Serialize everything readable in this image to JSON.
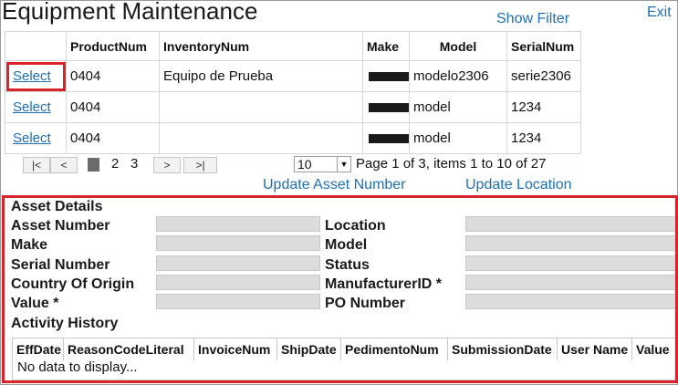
{
  "header": {
    "title": "Equipment Maintenance",
    "show_filter": "Show Filter",
    "exit": "Exit"
  },
  "grid": {
    "columns": [
      "",
      "ProductNum",
      "InventoryNum",
      "Make",
      "Model",
      "SerialNum"
    ],
    "rows": [
      {
        "select": "Select",
        "product": "0404",
        "inventory": "Equipo de Prueba",
        "model": "modelo2306",
        "serial": "serie2306"
      },
      {
        "select": "Select",
        "product": "0404",
        "inventory": "",
        "model": "model",
        "serial": "1234"
      },
      {
        "select": "Select",
        "product": "0404",
        "inventory": "",
        "model": "model",
        "serial": "1234"
      }
    ]
  },
  "pager": {
    "first": "|<",
    "prev": "<",
    "next": ">",
    "last": ">|",
    "current_page": "1",
    "page2": "2",
    "page3": "3",
    "page_size": "10",
    "page_size_arrow": "▼",
    "info": "Page 1 of 3, items 1 to 10 of 27"
  },
  "actions": {
    "update_asset": "Update Asset Number",
    "update_location": "Update Location"
  },
  "details": {
    "section_title": "Asset Details",
    "asset_number": "Asset Number",
    "make": "Make",
    "serial_number": "Serial Number",
    "country_of_origin": "Country Of Origin",
    "value": "Value *",
    "location": "Location",
    "model": "Model",
    "status": "Status",
    "manufacturer_id": "ManufacturerID *",
    "po_number": "PO Number"
  },
  "history": {
    "title": "Activity History",
    "columns": [
      "EffDate",
      "ReasonCodeLiteral",
      "InvoiceNum",
      "ShipDate",
      "PedimentoNum",
      "SubmissionDate",
      "User Name",
      "Value"
    ],
    "empty": "No data to display..."
  }
}
